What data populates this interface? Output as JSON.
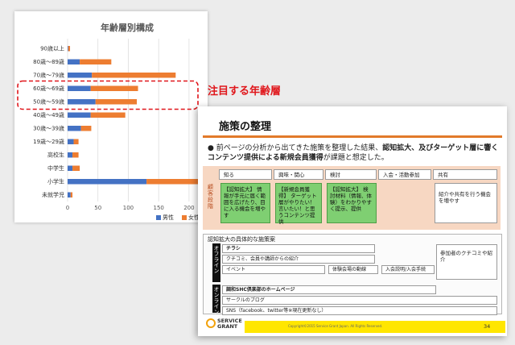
{
  "chart_data": {
    "type": "bar",
    "orientation": "horizontal",
    "stacked": true,
    "title": "年齢層別構成",
    "categories": [
      "90歳以上",
      "80歳～89歳",
      "70歳～79歳",
      "60歳～69歳",
      "50歳～59歳",
      "40歳～49歳",
      "30歳～39歳",
      "19歳～29歳",
      "高校生",
      "中学生",
      "小学生",
      "未就学児"
    ],
    "series": [
      {
        "name": "男性",
        "color": "#4472c4",
        "values": [
          1,
          20,
          40,
          38,
          46,
          38,
          22,
          10,
          8,
          8,
          130,
          5
        ]
      },
      {
        "name": "女性",
        "color": "#ed7d31",
        "values": [
          3,
          52,
          138,
          78,
          68,
          57,
          17,
          8,
          10,
          12,
          135,
          3
        ]
      }
    ],
    "xlim": [
      0,
      220
    ],
    "xticks": [
      0,
      50,
      100,
      150,
      200
    ],
    "grid": true,
    "legend": "bottom-right"
  },
  "callout": "注目する年齢層",
  "slide": {
    "title": "施策の整理",
    "bullet_text": "前ページの分析から出てきた施策を整理した結果、",
    "bullet_bold": "認知拡大、及びターゲット層に響くコンテンツ提供による新規会員獲得",
    "bullet_tail": "が課題と想定した。",
    "flow_label": "顧客段階",
    "stages": [
      "知る",
      "興味・関心",
      "検討",
      "入会・活動参加",
      "共有"
    ],
    "boxes": [
      "【認知拡大】 情報が手元に届く範囲を広げたり、目に入る機会を増やす",
      "【新規会員獲得】 ターゲット層がやりたい！言いたい！と思うコンテンツ提供",
      "【認知拡大】 検討材料（情報、体験）をわかりやすく提示、提供"
    ],
    "share_box": "紹介や共有を行う機会を増やす",
    "measures_title": "認知拡大の具体的な施策案",
    "offline_label": "オフライン",
    "online_label": "オンライン",
    "offline_rows": [
      "チラシ",
      "クチコミ、会員や講師からの紹介",
      "イベント",
      "体験会場の動線",
      "入会説明/入会手続"
    ],
    "referral_box": "参加者のクチコミや紹介",
    "online_rows": [
      "調和SHC倶楽部のホームページ",
      "サークルのブログ",
      "SNS（facebook、twitter等※現在更新なし）"
    ],
    "logo_line1": "SERVICE",
    "logo_line2": "GRANT",
    "copyright": "Copyright©2015 Service Grant Japan. All Rights Reserved.",
    "page_number": "34"
  }
}
